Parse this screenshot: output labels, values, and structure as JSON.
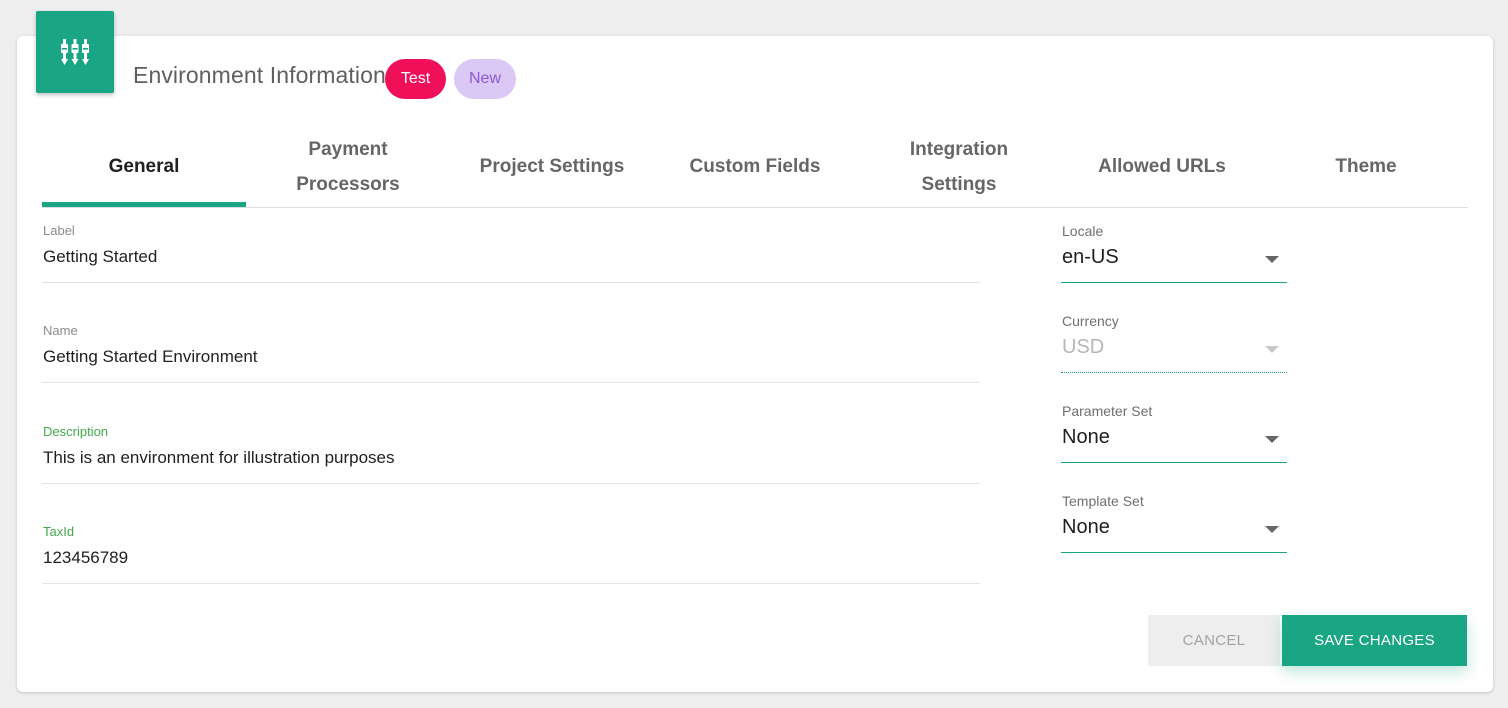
{
  "header": {
    "icon": "sliders-icon",
    "title": "Environment Information",
    "badges": [
      {
        "label": "Test",
        "color": "#f0105a"
      },
      {
        "label": "New",
        "color": "#dcc8f5"
      }
    ]
  },
  "tabs": [
    {
      "label": "General",
      "active": true
    },
    {
      "label": "Payment Processors"
    },
    {
      "label": "Project Settings"
    },
    {
      "label": "Custom Fields"
    },
    {
      "label": "Integration Settings"
    },
    {
      "label": "Allowed URLs"
    },
    {
      "label": "Theme"
    }
  ],
  "form": {
    "label": {
      "label": "Label",
      "value": "Getting Started"
    },
    "name": {
      "label": "Name",
      "value": "Getting Started Environment"
    },
    "description": {
      "label": "Description",
      "value": "This is an environment for illustration purposes"
    },
    "taxid": {
      "label": "TaxId",
      "value": "123456789"
    }
  },
  "selects": {
    "locale": {
      "label": "Locale",
      "value": "en-US"
    },
    "currency": {
      "label": "Currency",
      "value": "USD",
      "disabled": true
    },
    "parameter_set": {
      "label": "Parameter Set",
      "value": "None"
    },
    "template_set": {
      "label": "Template Set",
      "value": "None"
    }
  },
  "actions": {
    "cancel_label": "CANCEL",
    "save_label": "SAVE CHANGES"
  },
  "colors": {
    "accent": "#1aa584",
    "focus_label": "#43a84a"
  }
}
